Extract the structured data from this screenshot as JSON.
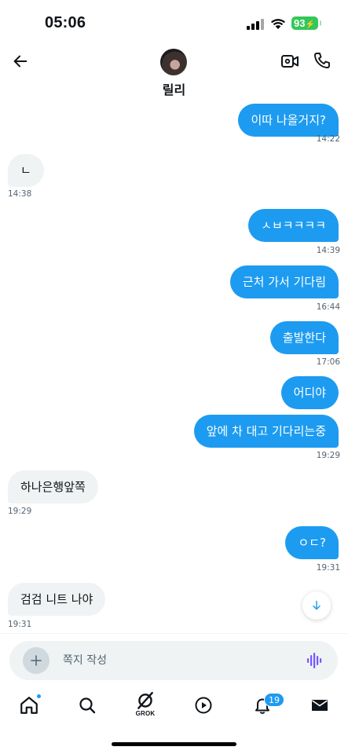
{
  "status_bar": {
    "time": "05:06",
    "battery": "93"
  },
  "header": {
    "contact_name": "릴리"
  },
  "messages": [
    {
      "dir": "out",
      "text": "이따 나올거지?",
      "time": "14:22"
    },
    {
      "dir": "in",
      "text": "ㄴ",
      "time": "14:38"
    },
    {
      "dir": "out",
      "text": "ㅅㅂㅋㅋㅋㅋ",
      "time": "14:39"
    },
    {
      "dir": "out",
      "text": "근처 가서 기다림",
      "time": "16:44"
    },
    {
      "dir": "out",
      "text": "출발한다",
      "time": "17:06"
    },
    {
      "dir": "out",
      "text": "어디야",
      "time": ""
    },
    {
      "dir": "out",
      "text": "앞에 차 대고 기다리는중",
      "time": "19:29"
    },
    {
      "dir": "in",
      "text": "하나은행앞쪽",
      "time": "19:29"
    },
    {
      "dir": "out",
      "text": "ㅇㄷ?",
      "time": "19:31"
    },
    {
      "dir": "in",
      "text": "검검 니트 나야",
      "time": "19:31"
    }
  ],
  "composer": {
    "placeholder": "쪽지 작성"
  },
  "nav": {
    "grok_label": "GROK",
    "notifications_count": "19"
  },
  "colors": {
    "accent": "#1d9bf0",
    "incoming_bubble": "#eff3f4",
    "battery": "#34c759",
    "voice": "#7856ff"
  }
}
